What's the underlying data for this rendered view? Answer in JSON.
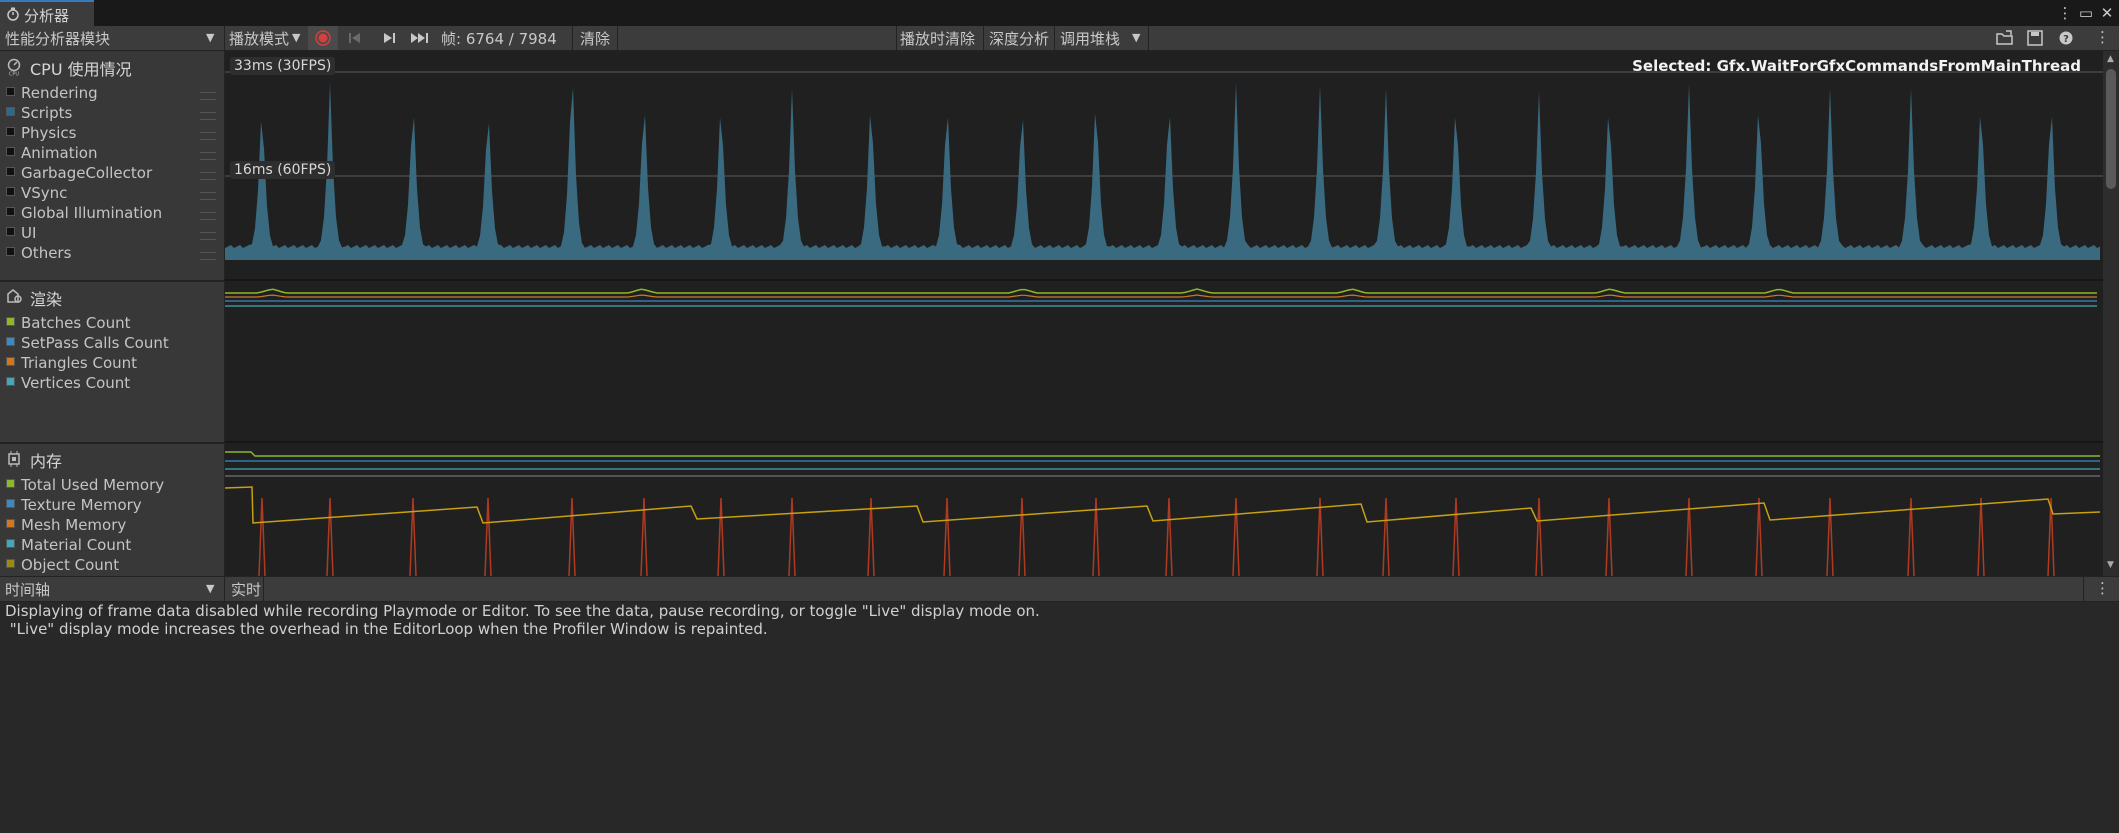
{
  "window": {
    "tab_title": "分析器",
    "tab_icon": "stopwatch-icon",
    "controls": [
      "more-vert-icon",
      "maximize-icon",
      "close-icon"
    ]
  },
  "toolbar": {
    "module_dropdown": "性能分析器模块",
    "playmode_dropdown": "播放模式",
    "frame_label": "帧: 6764 / 7984",
    "clear": "清除",
    "clear_on_play": "播放时清除",
    "deep_profile": "深度分析",
    "call_stacks": "调用堆栈",
    "icons": [
      "record-icon",
      "first-frame-icon",
      "next-frame-icon",
      "last-frame-icon",
      "load-icon",
      "save-icon",
      "help-icon",
      "more-vert-icon"
    ]
  },
  "modules": {
    "cpu": {
      "title": "CPU 使用情况",
      "icon": "cpu-icon",
      "legend": [
        {
          "label": "Rendering",
          "color": "#111111"
        },
        {
          "label": "Scripts",
          "color": "#2a6b8c"
        },
        {
          "label": "Physics",
          "color": "#111111"
        },
        {
          "label": "Animation",
          "color": "#111111"
        },
        {
          "label": "GarbageCollector",
          "color": "#111111"
        },
        {
          "label": "VSync",
          "color": "#111111"
        },
        {
          "label": "Global Illumination",
          "color": "#111111"
        },
        {
          "label": "UI",
          "color": "#111111"
        },
        {
          "label": "Others",
          "color": "#111111"
        }
      ],
      "fps30": "33ms (30FPS)",
      "fps60": "16ms (60FPS)",
      "selected": "Selected: Gfx.WaitForGfxCommandsFromMainThread",
      "chart_color": "#3a6a80"
    },
    "rendering": {
      "title": "渲染",
      "icon": "rendering-icon",
      "legend": [
        {
          "label": "Batches Count",
          "color": "#8cb82a"
        },
        {
          "label": "SetPass Calls Count",
          "color": "#3a8ac8"
        },
        {
          "label": "Triangles Count",
          "color": "#d07820"
        },
        {
          "label": "Vertices Count",
          "color": "#40a8b8"
        }
      ]
    },
    "memory": {
      "title": "内存",
      "icon": "chip-icon",
      "legend": [
        {
          "label": "Total Used Memory",
          "color": "#8cb82a"
        },
        {
          "label": "Texture Memory",
          "color": "#3a8ac8"
        },
        {
          "label": "Mesh Memory",
          "color": "#d07820"
        },
        {
          "label": "Material Count",
          "color": "#40a8b8"
        },
        {
          "label": "Object Count",
          "color": "#9a8a10"
        }
      ]
    }
  },
  "bottom": {
    "view_dropdown": "时间轴",
    "live": "实时",
    "message": "Displaying of frame data disabled while recording Playmode or Editor. To see the data, pause recording, or toggle \"Live\" display mode on.\n \"Live\" display mode increases the overhead in the EditorLoop when the Profiler Window is repainted."
  }
}
